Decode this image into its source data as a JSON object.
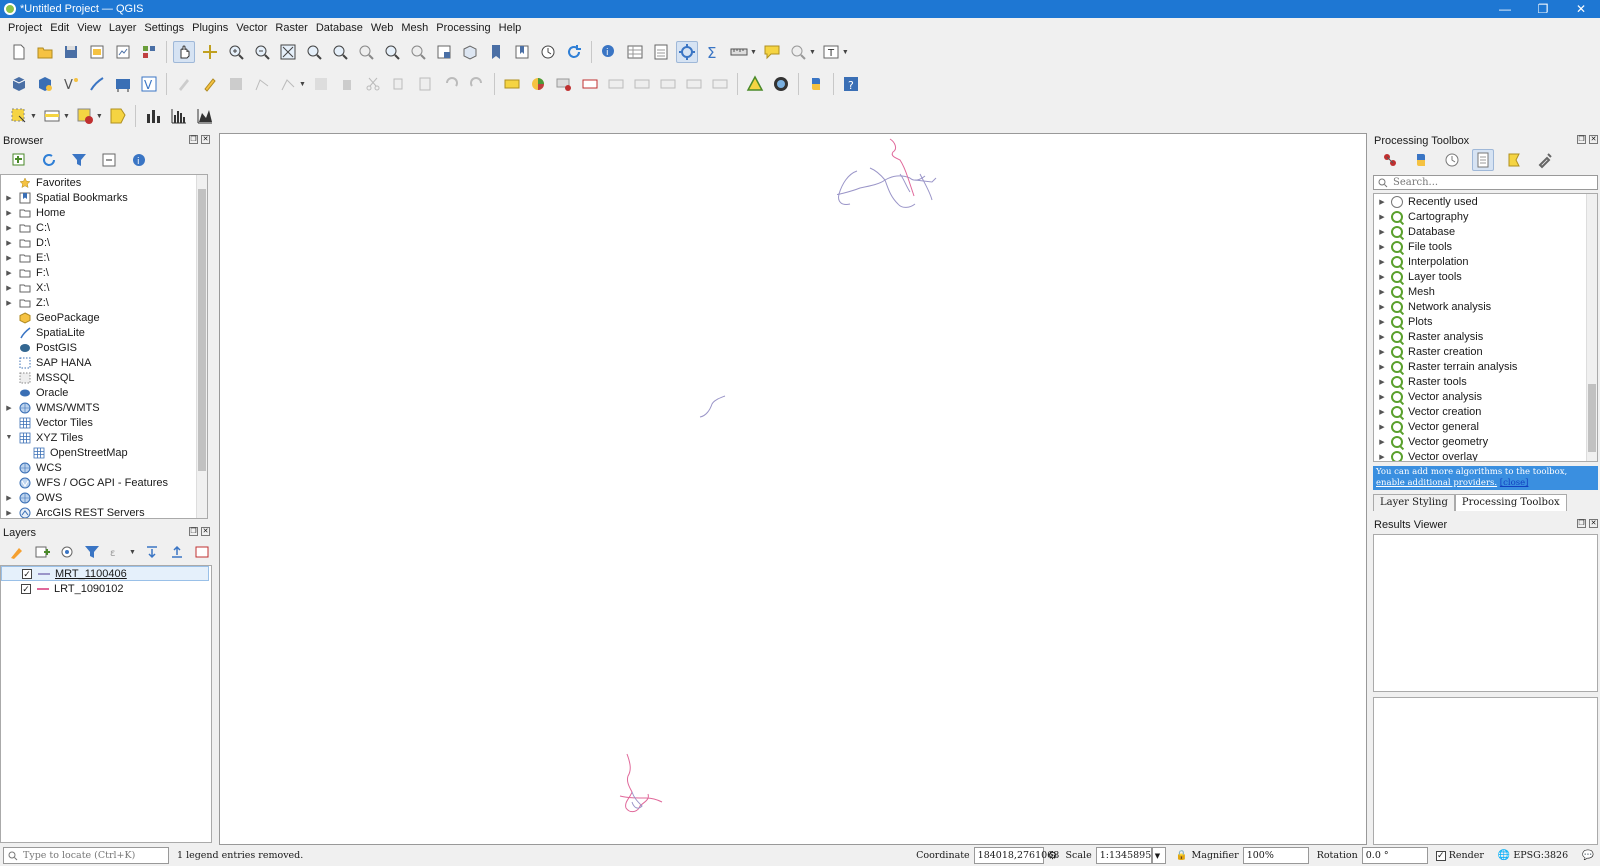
{
  "window": {
    "title": "*Untitled Project — QGIS",
    "controls": [
      "minimize",
      "restore",
      "close"
    ]
  },
  "menu": [
    "Project",
    "Edit",
    "View",
    "Layer",
    "Settings",
    "Plugins",
    "Vector",
    "Raster",
    "Database",
    "Web",
    "Mesh",
    "Processing",
    "Help"
  ],
  "browser": {
    "title": "Browser",
    "items": [
      {
        "label": "Favorites",
        "icon": "star-icon",
        "expandable": false,
        "indent": 0
      },
      {
        "label": "Spatial Bookmarks",
        "icon": "bookmark-icon",
        "expandable": true,
        "indent": 0
      },
      {
        "label": "Home",
        "icon": "folder-icon",
        "expandable": true,
        "indent": 0
      },
      {
        "label": "C:\\",
        "icon": "folder-icon",
        "expandable": true,
        "indent": 0
      },
      {
        "label": "D:\\",
        "icon": "folder-icon",
        "expandable": true,
        "indent": 0
      },
      {
        "label": "E:\\",
        "icon": "folder-icon",
        "expandable": true,
        "indent": 0
      },
      {
        "label": "F:\\",
        "icon": "folder-icon",
        "expandable": true,
        "indent": 0
      },
      {
        "label": "X:\\",
        "icon": "folder-icon",
        "expandable": true,
        "indent": 0
      },
      {
        "label": "Z:\\",
        "icon": "folder-icon",
        "expandable": true,
        "indent": 0
      },
      {
        "label": "GeoPackage",
        "icon": "geopackage-icon",
        "expandable": false,
        "indent": 0
      },
      {
        "label": "SpatiaLite",
        "icon": "spatialite-icon",
        "expandable": false,
        "indent": 0
      },
      {
        "label": "PostGIS",
        "icon": "postgis-icon",
        "expandable": false,
        "indent": 0
      },
      {
        "label": "SAP HANA",
        "icon": "hana-icon",
        "expandable": false,
        "indent": 0
      },
      {
        "label": "MSSQL",
        "icon": "mssql-icon",
        "expandable": false,
        "indent": 0
      },
      {
        "label": "Oracle",
        "icon": "oracle-icon",
        "expandable": false,
        "indent": 0
      },
      {
        "label": "WMS/WMTS",
        "icon": "globe-icon",
        "expandable": true,
        "indent": 0
      },
      {
        "label": "Vector Tiles",
        "icon": "grid-icon",
        "expandable": false,
        "indent": 0
      },
      {
        "label": "XYZ Tiles",
        "icon": "grid-icon",
        "expandable": true,
        "expanded": true,
        "indent": 0
      },
      {
        "label": "OpenStreetMap",
        "icon": "grid-icon",
        "expandable": false,
        "indent": 1
      },
      {
        "label": "WCS",
        "icon": "globe-icon",
        "expandable": false,
        "indent": 0
      },
      {
        "label": "WFS / OGC API - Features",
        "icon": "wfs-icon",
        "expandable": false,
        "indent": 0
      },
      {
        "label": "OWS",
        "icon": "globe-icon",
        "expandable": true,
        "indent": 0
      },
      {
        "label": "ArcGIS REST Servers",
        "icon": "arcgis-icon",
        "expandable": true,
        "indent": 0
      }
    ]
  },
  "layers": {
    "title": "Layers",
    "items": [
      {
        "label": "MRT_1100406",
        "checked": true,
        "color": "#9a95c8",
        "selected": true
      },
      {
        "label": "LRT_1090102",
        "checked": true,
        "color": "#e0689a",
        "selected": false
      }
    ]
  },
  "processing": {
    "title": "Processing Toolbox",
    "search_placeholder": "Search...",
    "items": [
      "Recently used",
      "Cartography",
      "Database",
      "File tools",
      "Interpolation",
      "Layer tools",
      "Mesh",
      "Network analysis",
      "Plots",
      "Raster analysis",
      "Raster creation",
      "Raster terrain analysis",
      "Raster tools",
      "Vector analysis",
      "Vector creation",
      "Vector general",
      "Vector geometry",
      "Vector overlay"
    ],
    "info_text": "You can add more algorithms to the toolbox, ",
    "info_link1": "enable additional providers.",
    "info_link2": "[close]",
    "tabs": [
      "Layer Styling",
      "Processing Toolbox"
    ],
    "active_tab": "Processing Toolbox"
  },
  "results": {
    "title": "Results Viewer"
  },
  "status": {
    "locate_placeholder": "Type to locate (Ctrl+K)",
    "message": "1 legend entries removed.",
    "coordinate_label": "Coordinate",
    "coordinate": "184018,2761068",
    "scale_label": "Scale",
    "scale": "1:1345895",
    "magnifier_label": "Magnifier",
    "magnifier": "100%",
    "rotation_label": "Rotation",
    "rotation": "0.0 °",
    "render_label": "Render",
    "crs": "EPSG:3826"
  },
  "colors": {
    "titlebar": "#1e77d3",
    "mrt_line": "#9a95c8",
    "lrt_line": "#e0689a",
    "info_bar": "#3a8fe0"
  }
}
